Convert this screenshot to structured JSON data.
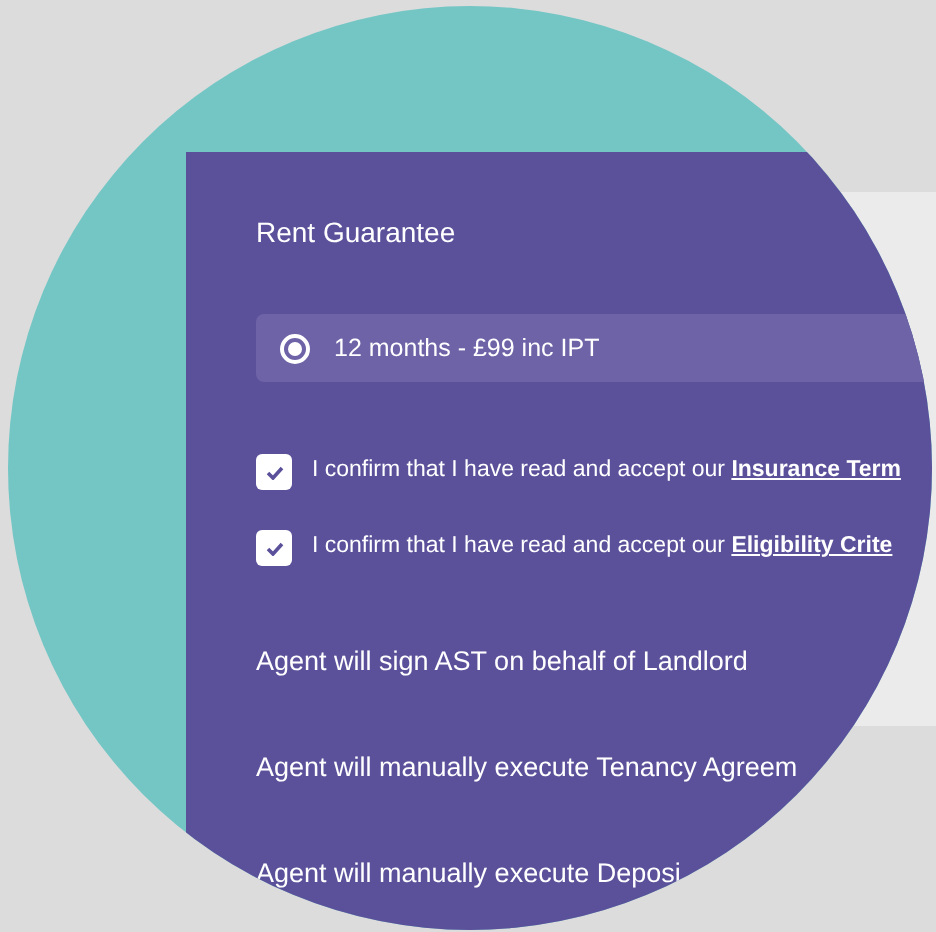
{
  "section_title": "Rent Guarantee",
  "options": [
    {
      "label": "12 months - £99 inc IPT",
      "selected": true
    }
  ],
  "confirmations": [
    {
      "text": "I confirm that I have read and accept our",
      "link": "Insurance Term",
      "checked": true
    },
    {
      "text": "I confirm that I have read and accept our",
      "link": "Eligibility Crite",
      "checked": true
    }
  ],
  "agent_options": [
    "Agent will sign AST on behalf of Landlord",
    "Agent will manually execute Tenancy Agreem",
    "Agent will manually execute Deposi"
  ]
}
